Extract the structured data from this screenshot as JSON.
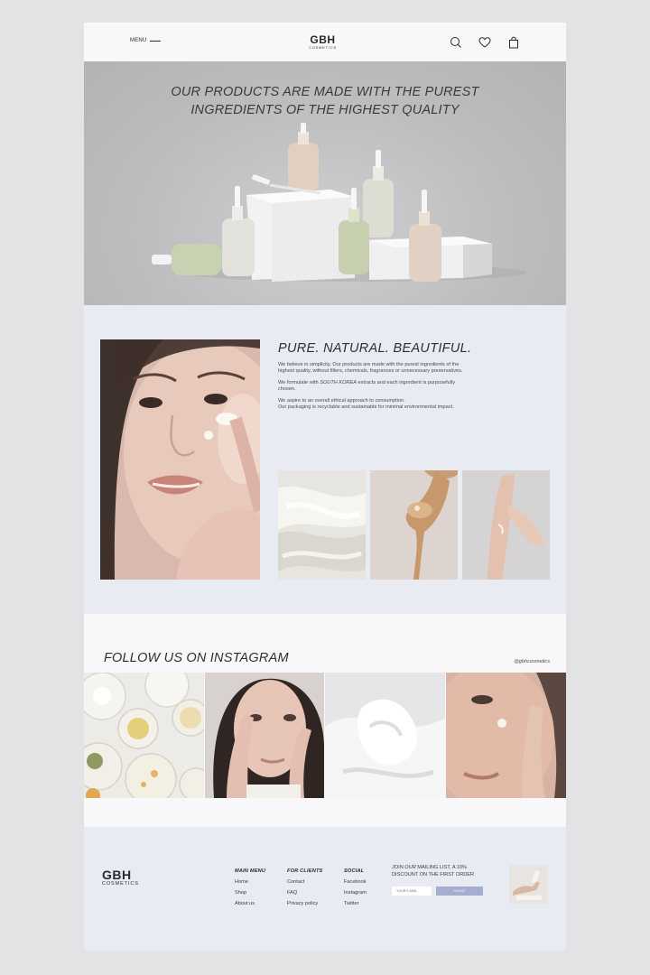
{
  "header": {
    "menu_label": "MENU",
    "logo_main": "GBH",
    "logo_sub": "COSMETICS",
    "icons": [
      "search-icon",
      "heart-icon",
      "bag-icon"
    ]
  },
  "hero": {
    "title_line1": "OUR PRODUCTS ARE MADE WITH THE PUREST",
    "title_line2": "INGREDIENTS OF THE HIGHEST QUALITY"
  },
  "about": {
    "title": "PURE. NATURAL. BEAUTIFUL.",
    "p1": "We believe in simplicity. Our products are made with the purest ingredients of the highest quality, without fillers, chemicals, fragrances or unnecessary preservatives.",
    "p2_before": "We formulate with ",
    "p2_em": "SOUTH KOREA",
    "p2_after": " extracts and each ingredient is purposefully chosen.",
    "p3_line1": "We aspire to an overall ethical approach to consumption.",
    "p3_line2": "Our packaging is recyclable and sustainable for minimal environmental impact."
  },
  "instagram": {
    "title": "FOLLOW US ON INSTAGRAM",
    "handle": "@gbhcosmetics"
  },
  "footer": {
    "logo_main": "GBH",
    "logo_sub": "COSMETICS",
    "main_menu": {
      "heading": "MAIN MENU",
      "links": [
        "Home",
        "Shop",
        "About us"
      ]
    },
    "for_clients": {
      "heading": "FOR CLIENTS",
      "links": [
        "Contact",
        "FAQ",
        "Privacy policy"
      ]
    },
    "social": {
      "heading": "SOCIAL",
      "links": [
        "Facebook",
        "Instagram",
        "Twitter"
      ]
    },
    "mailing_text_prefix": "JOIN ",
    "mailing_text_em": "OUR",
    "mailing_text_suffix": " MAILING LIST, A 10% DISCOUNT ON THE FIRST ORDER",
    "email_placeholder": "YOUR E-MAIL",
    "submit_label": "SUBMIT"
  },
  "colors": {
    "page_bg": "#e3e3e5",
    "section_bg": "#e9ebf2",
    "submit_button": "#a6aed0"
  }
}
